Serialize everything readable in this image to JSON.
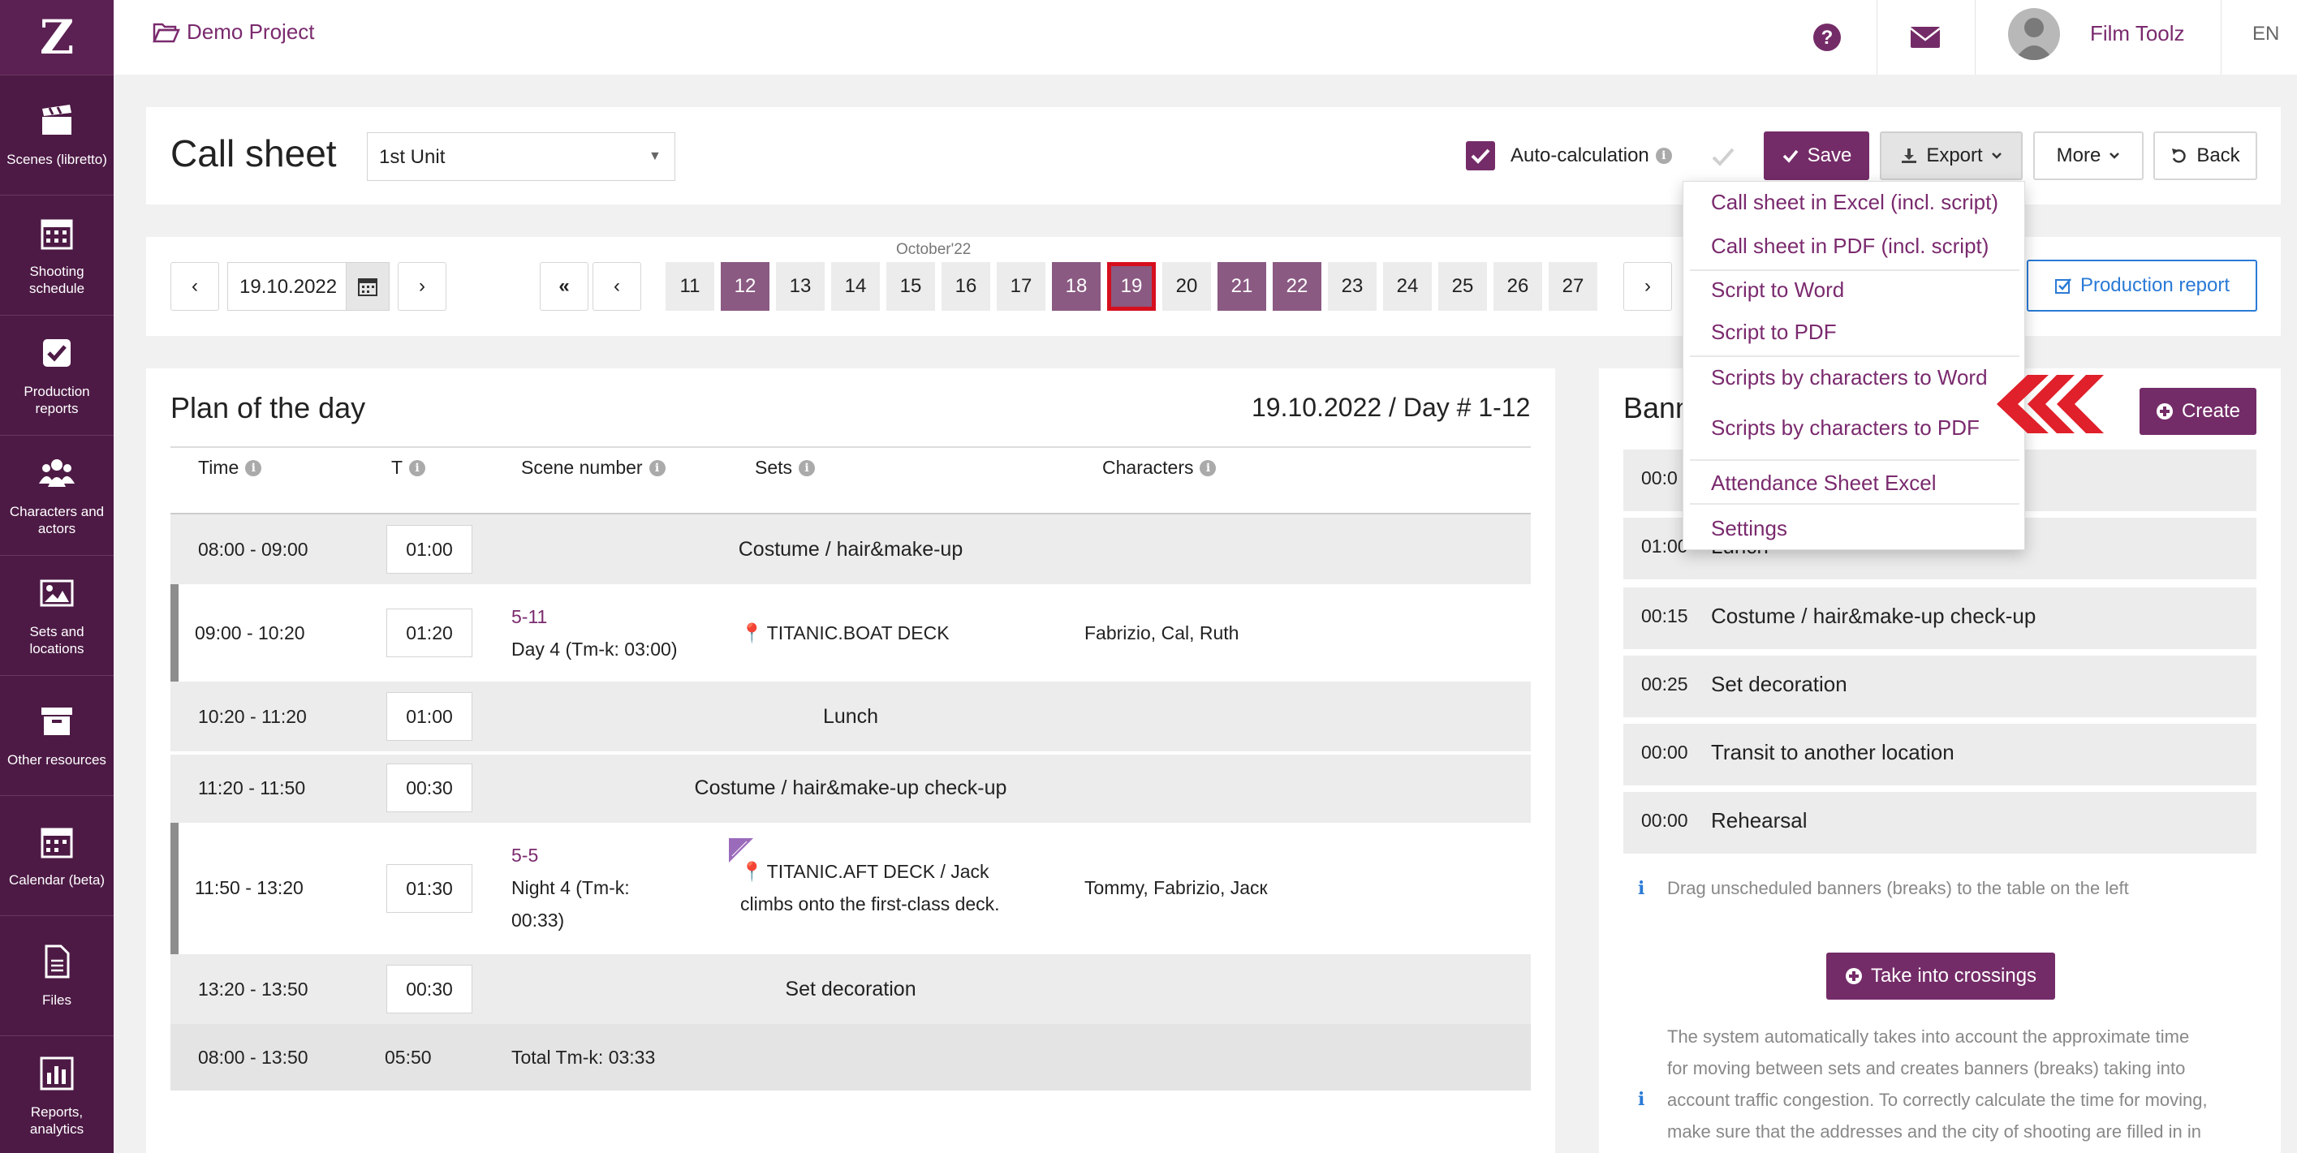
{
  "sidebar": {
    "logo": "Z",
    "items": [
      {
        "label": "Scenes (libretto)",
        "icon": "clapperboard-icon"
      },
      {
        "label": "Shooting schedule",
        "icon": "calendar-grid-icon"
      },
      {
        "label": "Production reports",
        "icon": "checkbox-icon"
      },
      {
        "label": "Characters and actors",
        "icon": "users-icon"
      },
      {
        "label": "Sets and locations",
        "icon": "picture-icon"
      },
      {
        "label": "Other resources",
        "icon": "archive-box-icon"
      },
      {
        "label": "Calendar (beta)",
        "icon": "calendar-icon"
      },
      {
        "label": "Files",
        "icon": "file-icon"
      },
      {
        "label": "Reports, analytics",
        "icon": "bar-chart-icon"
      }
    ]
  },
  "topbar": {
    "project": "Demo Project",
    "user": "Film Toolz",
    "language": "EN"
  },
  "header": {
    "title": "Call sheet",
    "unit_select": "1st Unit",
    "auto_calc_label": "Auto-calculation",
    "auto_calc_checked": true,
    "save": "Save",
    "export": "Export",
    "more": "More",
    "back": "Back"
  },
  "date_nav": {
    "date": "19.10.2022",
    "month": "October'22",
    "days": [
      "11",
      "12",
      "13",
      "14",
      "15",
      "16",
      "17",
      "18",
      "19",
      "20",
      "21",
      "22",
      "23",
      "24",
      "25",
      "26",
      "27"
    ],
    "highlighted_days": [
      "12",
      "18",
      "21",
      "22"
    ],
    "current_day": "19",
    "production_report": "Production report"
  },
  "plan": {
    "title": "Plan of the day",
    "summary": "19.10.2022 / Day # 1-12",
    "columns": {
      "time": "Time",
      "t": "T",
      "scene": "Scene number",
      "sets": "Sets",
      "characters": "Characters"
    },
    "rows": [
      {
        "time": "08:00 - 09:00",
        "t": "01:00",
        "banner": "Costume / hair&make-up"
      },
      {
        "time": "09:00 - 10:20",
        "t": "01:20",
        "scene": "5-11",
        "scene_desc": "Day 4 (Tm-k: 03:00)",
        "set": "TITANIC.BOAT DECK",
        "characters": "Fabrizio, Cal, Ruth"
      },
      {
        "time": "10:20 - 11:20",
        "t": "01:00",
        "banner": "Lunch"
      },
      {
        "time": "11:20 - 11:50",
        "t": "00:30",
        "banner": "Costume / hair&make-up check-up"
      },
      {
        "time": "11:50 - 13:20",
        "t": "01:30",
        "scene": "5-5",
        "scene_desc_1": "Night 4 (Tm-k:",
        "scene_desc_2": "00:33)",
        "set_1": "TITANIC.AFT DECK / Jack",
        "set_2": "climbs onto the first-class deck.",
        "characters": "Tommy, Fabrizio, Jaск"
      },
      {
        "time": "13:20 - 13:50",
        "t": "00:30",
        "banner": "Set decoration"
      }
    ],
    "total": {
      "time": "08:00 - 13:50",
      "t": "05:50",
      "label": "Total Tm-k: 03:33"
    }
  },
  "banners": {
    "title": "Bann",
    "create": "Create",
    "rows": [
      {
        "t": "00:0",
        "name": ""
      },
      {
        "t": "01:00",
        "name": "Lunch"
      },
      {
        "t": "00:15",
        "name": "Costume / hair&make-up check-up"
      },
      {
        "t": "00:25",
        "name": "Set decoration"
      },
      {
        "t": "00:00",
        "name": "Transit to another location"
      },
      {
        "t": "00:00",
        "name": "Rehearsal"
      }
    ],
    "hint": "Drag unscheduled banners (breaks) to the table on the left",
    "take_into_crossings": "Take into crossings",
    "info_lines": [
      "The system automatically takes into account the approximate time",
      "for moving between sets and creates banners (breaks) taking into",
      "account traffic congestion. To correctly calculate the time for moving,",
      "make sure that the addresses and the city of shooting are filled in in"
    ]
  },
  "export_menu": {
    "items": [
      "Call sheet in Excel (incl. script)",
      "Call sheet in PDF (incl. script)",
      "Script to Word",
      "Script to PDF",
      "Scripts by characters to Word",
      "Scripts by characters to PDF",
      "Attendance Sheet Excel",
      "Settings"
    ]
  },
  "colors": {
    "brand": "#742c68",
    "sidebar": "#4d1a45",
    "highlight": "#8a5a82",
    "current_border": "#d60f1e",
    "arrow_red": "#e0202a"
  }
}
